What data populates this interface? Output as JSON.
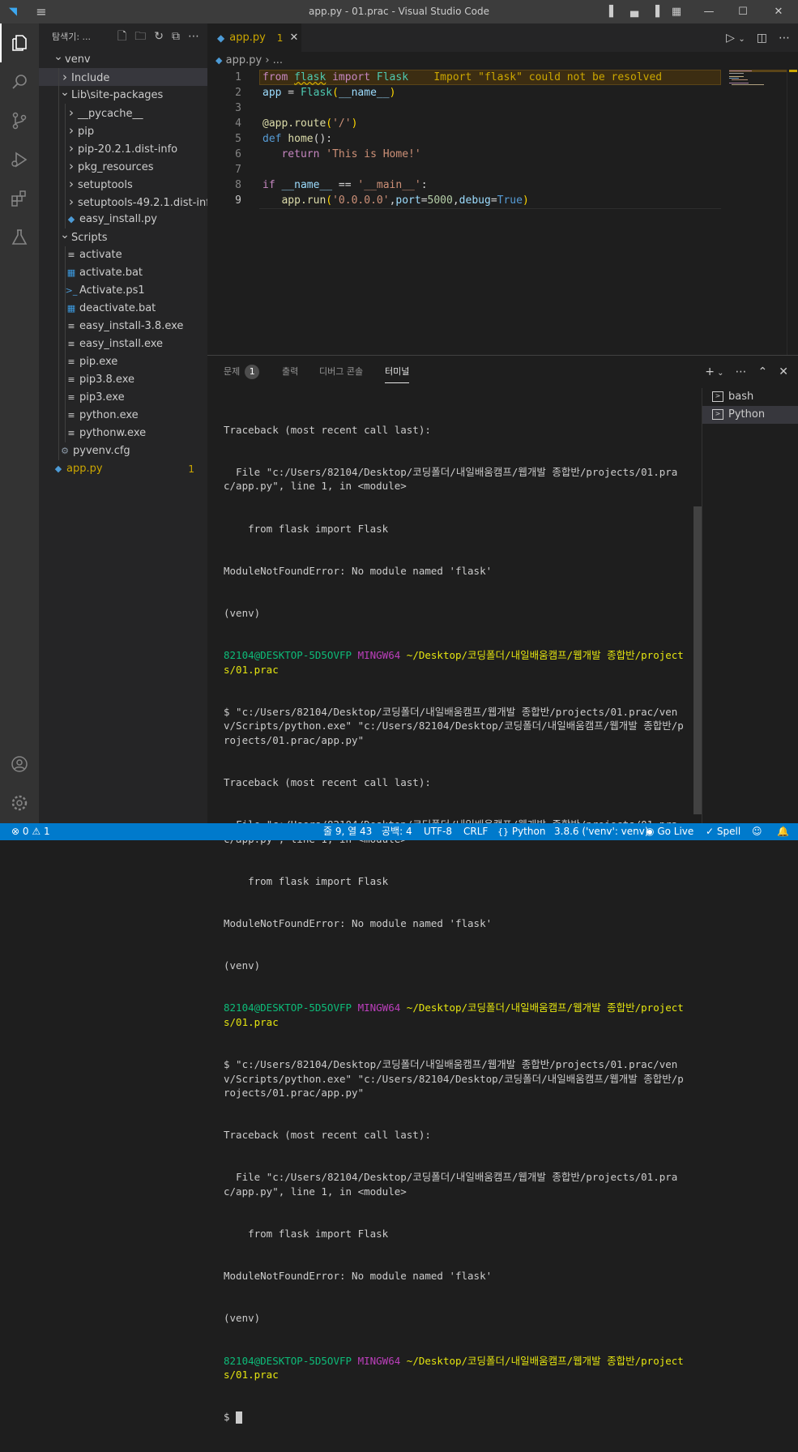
{
  "window": {
    "title": "app.py - 01.prac - Visual Studio Code"
  },
  "sidebar": {
    "header": "탐색기: ...",
    "tree": [
      {
        "label": "venv",
        "indent": 0,
        "chevron": "v",
        "icon": ""
      },
      {
        "label": "Include",
        "indent": 1,
        "chevron": ">",
        "icon": "",
        "selected": true
      },
      {
        "label": "Lib\\site-packages",
        "indent": 1,
        "chevron": "v",
        "icon": ""
      },
      {
        "label": "__pycache__",
        "indent": 2,
        "chevron": ">",
        "icon": ""
      },
      {
        "label": "pip",
        "indent": 2,
        "chevron": ">",
        "icon": ""
      },
      {
        "label": "pip-20.2.1.dist-info",
        "indent": 2,
        "chevron": ">",
        "icon": ""
      },
      {
        "label": "pkg_resources",
        "indent": 2,
        "chevron": ">",
        "icon": ""
      },
      {
        "label": "setuptools",
        "indent": 2,
        "chevron": ">",
        "icon": ""
      },
      {
        "label": "setuptools-49.2.1.dist-info",
        "indent": 2,
        "chevron": ">",
        "icon": ""
      },
      {
        "label": "easy_install.py",
        "indent": 2,
        "chevron": "",
        "icon": "python"
      },
      {
        "label": "Scripts",
        "indent": 1,
        "chevron": "v",
        "icon": ""
      },
      {
        "label": "activate",
        "indent": 2,
        "chevron": "",
        "icon": "lines"
      },
      {
        "label": "activate.bat",
        "indent": 2,
        "chevron": "",
        "icon": "windows"
      },
      {
        "label": "Activate.ps1",
        "indent": 2,
        "chevron": "",
        "icon": "powershell"
      },
      {
        "label": "deactivate.bat",
        "indent": 2,
        "chevron": "",
        "icon": "windows"
      },
      {
        "label": "easy_install-3.8.exe",
        "indent": 2,
        "chevron": "",
        "icon": "lines"
      },
      {
        "label": "easy_install.exe",
        "indent": 2,
        "chevron": "",
        "icon": "lines"
      },
      {
        "label": "pip.exe",
        "indent": 2,
        "chevron": "",
        "icon": "lines"
      },
      {
        "label": "pip3.8.exe",
        "indent": 2,
        "chevron": "",
        "icon": "lines"
      },
      {
        "label": "pip3.exe",
        "indent": 2,
        "chevron": "",
        "icon": "lines"
      },
      {
        "label": "python.exe",
        "indent": 2,
        "chevron": "",
        "icon": "lines"
      },
      {
        "label": "pythonw.exe",
        "indent": 2,
        "chevron": "",
        "icon": "lines"
      },
      {
        "label": "pyvenv.cfg",
        "indent": 1,
        "chevron": "",
        "icon": "gear"
      },
      {
        "label": "app.py",
        "indent": 0,
        "chevron": "",
        "icon": "python",
        "warn": true,
        "badge": "1"
      }
    ]
  },
  "tab": {
    "name": "app.py",
    "count": "1",
    "close": "✕"
  },
  "breadcrumb": {
    "file": "app.py",
    "sep": "›",
    "rest": "..."
  },
  "editor": {
    "lines": [
      "1",
      "2",
      "3",
      "4",
      "5",
      "6",
      "7",
      "8",
      "9"
    ],
    "warning_message": "Import \"flask\" could not be resolved",
    "tokens": {
      "from": "from",
      "flask": "flask",
      "import": "import",
      "Flask": "Flask",
      "app": "app",
      "eq": " = ",
      "name": "__name__",
      "paren_open": "(",
      "paren_close": ")",
      "decorator": "@app.route",
      "route_arg": "'/'",
      "def": "def",
      "home": "home",
      "home_sig": "():",
      "return": "return",
      "return_str": "'This is Home!'",
      "if": "if",
      "eqeq": " == ",
      "main_str": "'__main__'",
      "colon": ":",
      "run": "app.run",
      "host": "'0.0.0.0'",
      "port_kw": "port",
      "port_val": "5000",
      "debug_kw": "debug",
      "debug_val": "True"
    }
  },
  "panel": {
    "tabs": [
      {
        "label": "문제",
        "badge": "1"
      },
      {
        "label": "출력"
      },
      {
        "label": "디버그 콘솔"
      },
      {
        "label": "터미널",
        "active": true
      }
    ],
    "terminals": [
      "bash",
      "Python"
    ],
    "terminal": {
      "traceback": "Traceback (most recent call last):",
      "file_line": "  File \"c:/Users/82104/Desktop/코딩폴더/내일배움캠프/웹개발 종합반/projects/01.prac/app.py\", line 1, in <module>",
      "import_line": "    from flask import Flask",
      "error": "ModuleNotFoundError: No module named 'flask'",
      "venv": "(venv)",
      "user": "82104@DESKTOP-5D5OVFP",
      "shell": "MINGW64",
      "path": "~/Desktop/코딩폴더/내일배움캠프/웹개발 종합반/projects/01.prac",
      "command": "$ \"c:/Users/82104/Desktop/코딩폴더/내일배움캠프/웹개발 종합반/projects/01.prac/venv/Scripts/python.exe\" \"c:/Users/82104/Desktop/코딩폴더/내일배움캠프/웹개발 종합반/projects/01.prac/app.py\"",
      "prompt": "$ "
    }
  },
  "status": {
    "errors": "0",
    "warnings": "1",
    "position": "줄 9, 열 43",
    "spaces": "공백: 4",
    "encoding": "UTF-8",
    "eol": "CRLF",
    "language": "Python",
    "interpreter": "3.8.6 ('venv': venv)",
    "golive": "Go Live",
    "spell": "Spell"
  },
  "colors": {
    "statusbar": "#007acc",
    "warning": "#cca700",
    "python_icon": "#4d9bd6"
  }
}
